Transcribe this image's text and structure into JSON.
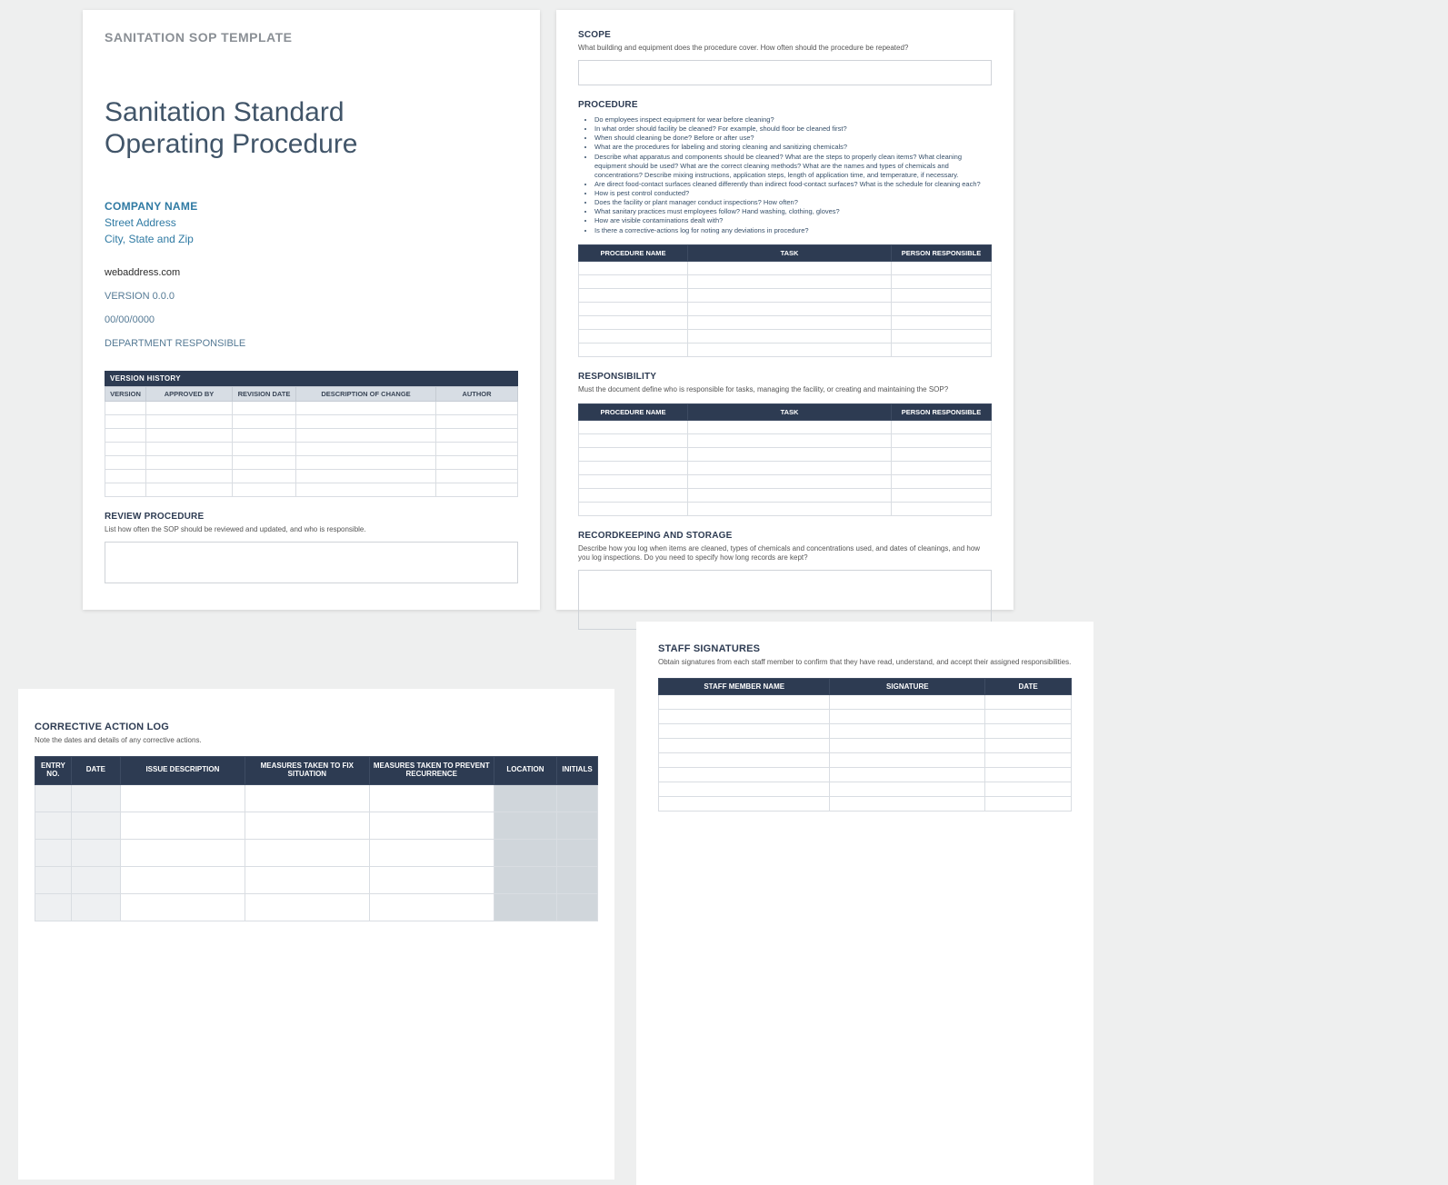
{
  "page1": {
    "template_label": "SANITATION SOP TEMPLATE",
    "title_line1": "Sanitation Standard",
    "title_line2": "Operating Procedure",
    "company_name": "COMPANY NAME",
    "street": "Street Address",
    "city": "City, State and Zip",
    "web": "webaddress.com",
    "version": "VERSION 0.0.0",
    "date": "00/00/0000",
    "dept": "DEPARTMENT RESPONSIBLE",
    "vh_bar": "VERSION HISTORY",
    "vh_cols": [
      "VERSION",
      "APPROVED BY",
      "REVISION DATE",
      "DESCRIPTION OF CHANGE",
      "AUTHOR"
    ],
    "vh_rows": 7,
    "review_h": "REVIEW PROCEDURE",
    "review_sub": "List how often the SOP should be reviewed and updated, and who is responsible."
  },
  "page2": {
    "scope_h": "SCOPE",
    "scope_sub": "What building and equipment does the procedure cover. How often should the procedure be repeated?",
    "proc_h": "PROCEDURE",
    "proc_items": [
      "Do employees inspect equipment for wear before cleaning?",
      "In what order should facility be cleaned? For example, should floor be cleaned first?",
      "When should cleaning be done? Before or after use?",
      "What are the procedures for labeling and storing cleaning and sanitizing chemicals?",
      "Describe what apparatus and components should be cleaned? What are the steps to properly clean items? What cleaning equipment should be used? What are the correct cleaning methods? What are the names and types of chemicals and concentrations? Describe mixing instructions, application steps, length of application time, and temperature, if necessary.",
      "Are direct food-contact surfaces cleaned differently than indirect food-contact surfaces? What is the schedule for cleaning each?",
      "How is pest control conducted?",
      "Does the facility or plant manager conduct inspections? How often?",
      "What sanitary practices must employees follow? Hand washing, clothing, gloves?",
      "How are visible contaminations dealt with?",
      "Is there a corrective-actions log for noting any deviations in procedure?"
    ],
    "proc_cols": [
      "PROCEDURE NAME",
      "TASK",
      "PERSON RESPONSIBLE"
    ],
    "proc_rows": 7,
    "resp_h": "RESPONSIBILITY",
    "resp_sub": "Must the document define who is responsible for tasks, managing the facility, or creating and maintaining the SOP?",
    "resp_rows": 7,
    "rec_h": "RECORDKEEPING AND STORAGE",
    "rec_sub": "Describe how you log when items are cleaned, types of chemicals and concentrations used, and dates of cleanings, and how you log inspections. Do you need to specify how long records are kept?"
  },
  "page3": {
    "h": "CORRECTIVE ACTION LOG",
    "sub": "Note the dates and details of any corrective actions.",
    "cols": [
      "ENTRY NO.",
      "DATE",
      "ISSUE DESCRIPTION",
      "MEASURES TAKEN TO FIX SITUATION",
      "MEASURES TAKEN TO PREVENT RECURRENCE",
      "LOCATION",
      "INITIALS"
    ],
    "rows": 5
  },
  "page4": {
    "h": "STAFF SIGNATURES",
    "sub": "Obtain signatures from each staff member to confirm that they have read, understand, and accept their assigned responsibilities.",
    "cols": [
      "STAFF MEMBER NAME",
      "SIGNATURE",
      "DATE"
    ],
    "rows": 8
  }
}
